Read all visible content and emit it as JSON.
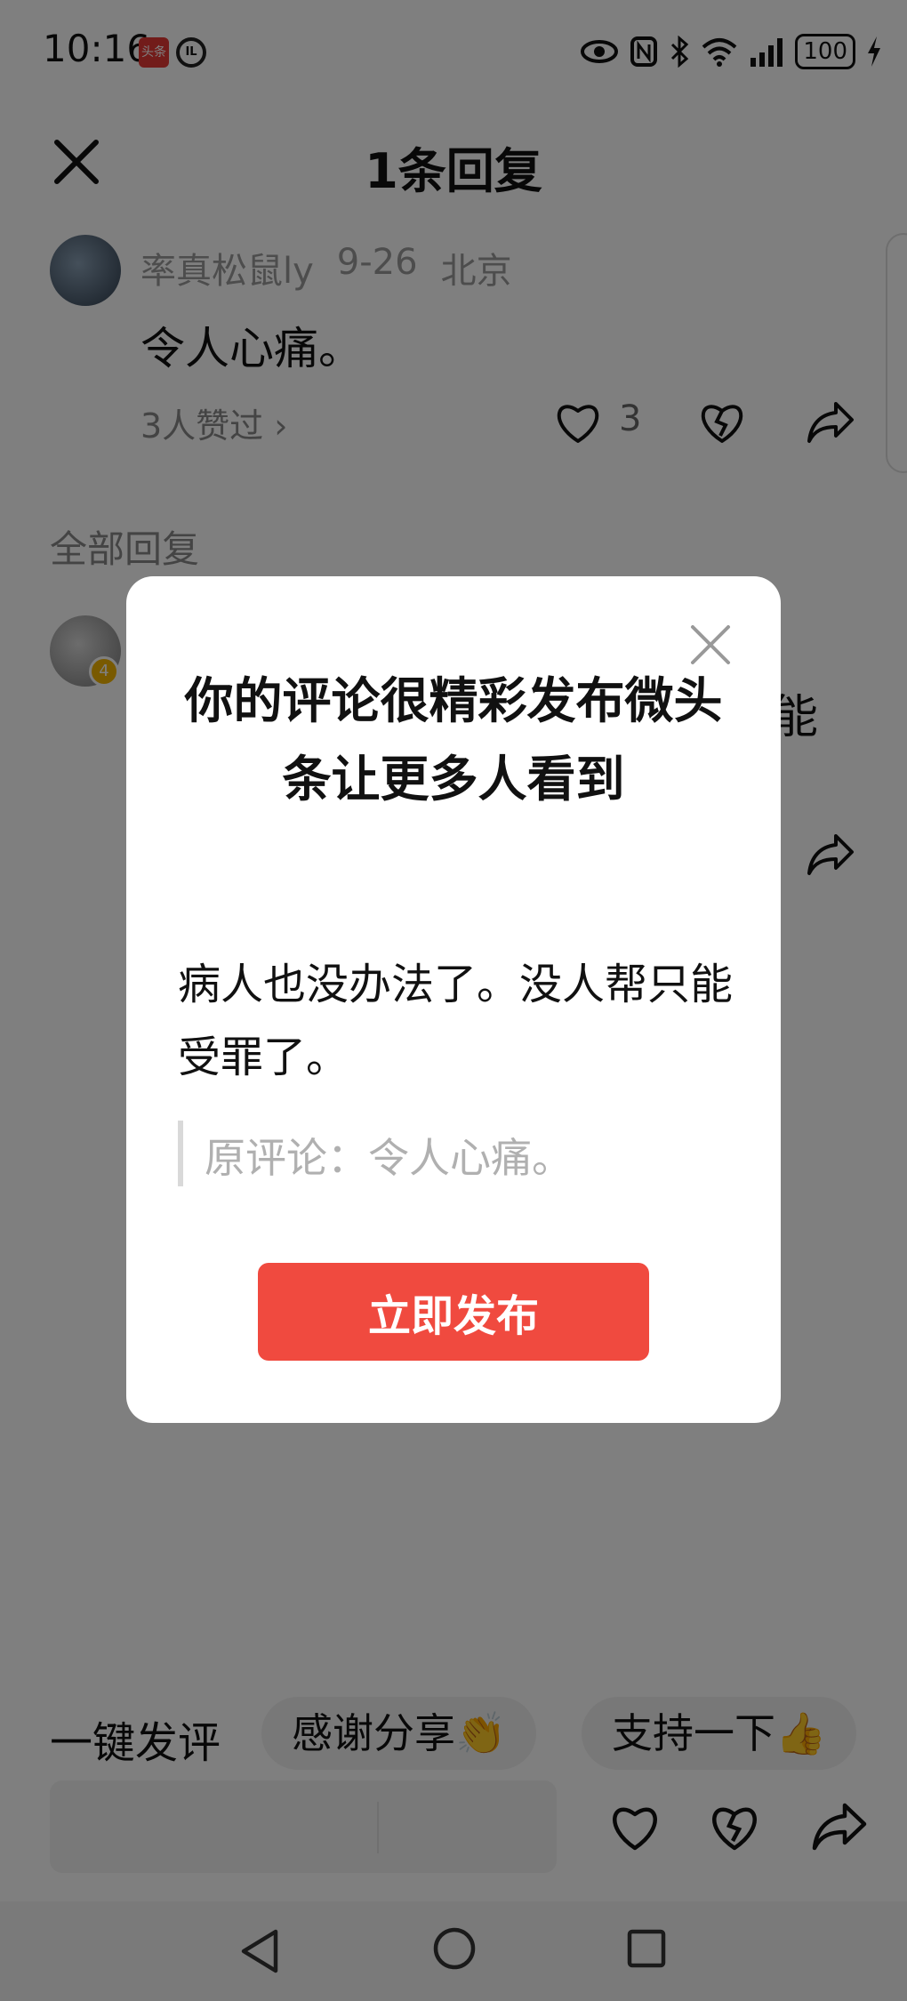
{
  "status_bar": {
    "time": "10:16",
    "app_icon_text": "头条",
    "app_icon2_text": "IL",
    "battery": "100"
  },
  "sheet": {
    "title": "1条回复"
  },
  "comment": {
    "username": "率真松鼠ly",
    "date": "9-26",
    "location": "北京",
    "text": "令人心痛。",
    "likes_link": "3人赞过 ›",
    "like_count": "3"
  },
  "replies_section": {
    "label": "全部回复",
    "reply_text_tail": "能"
  },
  "quick_reply": {
    "label": "一键发评",
    "chips": [
      "感谢分享👏",
      "支持一下👍"
    ]
  },
  "dialog": {
    "title": "你的评论很精彩发布微头条让更多人看到",
    "body": "病人也没办法了。没人帮只能受罪了。",
    "quote": "原评论：令人心痛。",
    "publish_label": "立即发布"
  },
  "icons": {
    "close": "close-icon",
    "heart": "heart-icon",
    "broken_heart": "broken-heart-icon",
    "share": "share-icon",
    "nav_back": "nav-back-icon",
    "nav_home": "nav-home-icon",
    "nav_recent": "nav-recent-icon"
  },
  "colors": {
    "publish_button": "#f04a3f",
    "overlay": "rgba(0,0,0,0.5)"
  }
}
